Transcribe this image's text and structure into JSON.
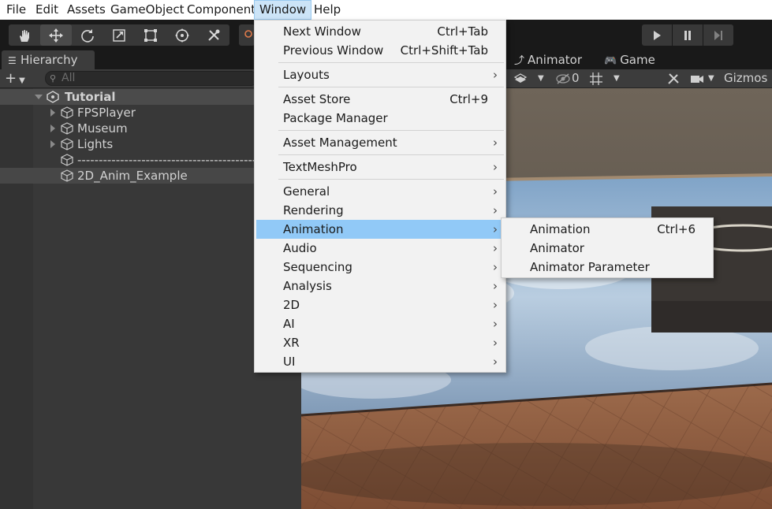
{
  "menubar": {
    "items": [
      {
        "label": "File"
      },
      {
        "label": "Edit"
      },
      {
        "label": "Assets"
      },
      {
        "label": "GameObject"
      },
      {
        "label": "Component"
      },
      {
        "label": "Window"
      },
      {
        "label": "Help"
      }
    ],
    "active": "Window"
  },
  "toolbar": {
    "tools": [
      "hand-tool-icon",
      "move-tool-icon",
      "rotate-tool-icon",
      "scale-tool-icon",
      "rect-tool-icon",
      "transform-tool-icon",
      "custom-tool-icon"
    ],
    "selected_tool": "move-tool-icon",
    "playback": [
      "play-icon",
      "pause-icon",
      "step-icon"
    ]
  },
  "hierarchy": {
    "tab_label": "Hierarchy",
    "search_placeholder": "All",
    "scene_name": "Tutorial",
    "items": [
      {
        "label": "FPSPlayer",
        "expandable": true
      },
      {
        "label": "Museum",
        "expandable": true
      },
      {
        "label": "Lights",
        "expandable": true
      },
      {
        "label": "------------------------------------------",
        "expandable": false
      },
      {
        "label": "2D_Anim_Example",
        "expandable": false,
        "selected": true
      }
    ]
  },
  "scene_panel": {
    "tabs": [
      {
        "label": "Animator"
      },
      {
        "label": "Game"
      }
    ],
    "hidden_objects_count": "0",
    "gizmos_label": "Gizmos"
  },
  "window_menu": {
    "groups": [
      [
        {
          "label": "Next Window",
          "shortcut": "Ctrl+Tab"
        },
        {
          "label": "Previous Window",
          "shortcut": "Ctrl+Shift+Tab"
        }
      ],
      [
        {
          "label": "Layouts",
          "submenu": true
        }
      ],
      [
        {
          "label": "Asset Store",
          "shortcut": "Ctrl+9"
        },
        {
          "label": "Package Manager"
        }
      ],
      [
        {
          "label": "Asset Management",
          "submenu": true
        }
      ],
      [
        {
          "label": "TextMeshPro",
          "submenu": true
        }
      ],
      [
        {
          "label": "General",
          "submenu": true
        },
        {
          "label": "Rendering",
          "submenu": true
        },
        {
          "label": "Animation",
          "submenu": true,
          "highlighted": true
        },
        {
          "label": "Audio",
          "submenu": true
        },
        {
          "label": "Sequencing",
          "submenu": true
        },
        {
          "label": "Analysis",
          "submenu": true
        },
        {
          "label": "2D",
          "submenu": true
        },
        {
          "label": "AI",
          "submenu": true
        },
        {
          "label": "XR",
          "submenu": true
        },
        {
          "label": "UI",
          "submenu": true
        }
      ]
    ],
    "submenu_glyph": "›"
  },
  "animation_submenu": {
    "items": [
      {
        "label": "Animation",
        "shortcut": "Ctrl+6"
      },
      {
        "label": "Animator"
      },
      {
        "label": "Animator Parameter"
      }
    ]
  },
  "colors": {
    "menu_highlight": "#91c9f7",
    "menubar_active": "#cce4f7",
    "editor_dark": "#191919",
    "panel": "#383838"
  }
}
